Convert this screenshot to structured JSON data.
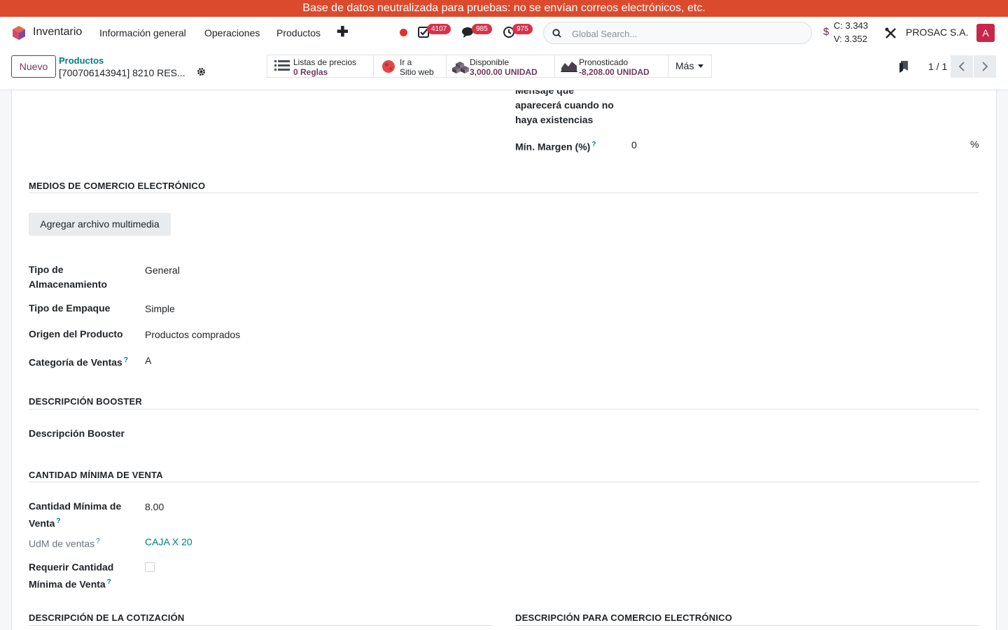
{
  "banner": {
    "text": "Base de datos neutralizada para pruebas: no se envían correos electrónicos, etc."
  },
  "navbar": {
    "app_name": "Inventario",
    "menu": [
      "Información general",
      "Operaciones",
      "Productos"
    ],
    "badges": {
      "activities": "4107",
      "messages": "985",
      "timers": "975"
    },
    "search_placeholder": "Global Search...",
    "rates": {
      "symbol": "$",
      "buy": "C: 3.343",
      "sell": "V: 3.352"
    },
    "company": "PROSAC S.A.",
    "avatar_letter": "A",
    "colors": {
      "brand": "#71395f",
      "banner": "#dc4a2e",
      "badge": "#d9324a",
      "link": "#017e84"
    }
  },
  "control": {
    "new_label": "Nuevo",
    "breadcrumb": "Productos",
    "record_title": "[700706143941] 8210 RES...",
    "smart_buttons": [
      {
        "top": "Listas de precios",
        "bottom": "0  Reglas"
      },
      {
        "top": "Ir a",
        "bottom": "Sitio web"
      },
      {
        "top": "Disponible",
        "bottom": "3,000.00 UNIDAD"
      },
      {
        "top": "Pronosticado",
        "bottom": "-8,208.00 UNIDAD"
      }
    ],
    "more_label": "Más",
    "pager": "1 / 1"
  },
  "form": {
    "out_of_stock_label": "Mensaje que aparecerá cuando no haya existencias",
    "out_of_stock_lines": [
      "Mensaje que",
      "aparecerá cuando no",
      "haya existencias"
    ],
    "min_margin": {
      "label": "Mín. Margen (%)",
      "value": "0",
      "unit": "%"
    },
    "ecommerce_media": {
      "title": "MEDIOS DE COMERCIO ELECTRÓNICO",
      "button": "Agregar archivo multimedia"
    },
    "fields": {
      "storage_type": {
        "label_lines": [
          "Tipo de",
          "Almacenamiento"
        ],
        "value": "General"
      },
      "packaging_type": {
        "label": "Tipo de Empaque",
        "value": "Simple"
      },
      "product_origin": {
        "label": "Origen del Producto",
        "value": "Productos comprados"
      },
      "sales_category": {
        "label": "Categoría de Ventas",
        "value": "A"
      }
    },
    "booster": {
      "title": "DESCRIPCIÓN BOOSTER",
      "field_label": "Descripción Booster"
    },
    "min_sale": {
      "title": "CANTIDAD MÍNIMA DE VENTA",
      "qty_label_lines": [
        "Cantidad Mínima de",
        "Venta"
      ],
      "qty_value": "8.00",
      "uom_label": "UdM de ventas",
      "uom_value": "CAJA X 20",
      "require_label_lines": [
        "Requerir Cantidad",
        "Mínima de Venta"
      ],
      "require_checked": false
    },
    "quote_desc_title": "DESCRIPCIÓN DE LA COTIZACIÓN",
    "ecom_desc_title": "DESCRIPCIÓN PARA COMERCIO ELECTRÓNICO",
    "help_mark": "?"
  }
}
